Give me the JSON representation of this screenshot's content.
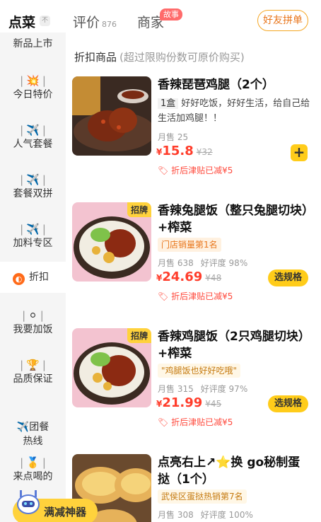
{
  "tabs": {
    "order": {
      "label": "点菜",
      "badge": "不"
    },
    "review": {
      "label": "评价",
      "count": "876"
    },
    "merchant": {
      "label": "商家",
      "badge": "故事"
    },
    "friend_group": "好友拼单"
  },
  "sidebar": {
    "items": [
      {
        "label": "新品上市",
        "icon": ""
      },
      {
        "label": "今日特价",
        "icon": "💥"
      },
      {
        "label": "人气套餐",
        "icon": "✈️"
      },
      {
        "label": "套餐双拼",
        "icon": "✈️"
      },
      {
        "label": "加料专区",
        "icon": "✈️"
      },
      {
        "label": "折扣",
        "icon": "◐"
      },
      {
        "label": "我要加饭",
        "icon": "⚪"
      },
      {
        "label": "品质保证",
        "icon": "🏆"
      },
      {
        "label": "✈️团餐\n热线",
        "icon": ""
      },
      {
        "label": "来点喝的",
        "icon": "🥇"
      }
    ]
  },
  "section": {
    "title": "折扣商品",
    "subtitle": "(超过限购份数可原价购买)"
  },
  "items": [
    {
      "name": "香辣琵琶鸡腿（2个）",
      "unit": "1盒",
      "desc": "好好吃饭，好好生活，给自己给生活加鸡腿！！",
      "sales": "月售 25",
      "rating": "",
      "currency": "¥",
      "price": "15.8",
      "original": "¥32",
      "discount": "折后津贴已减¥5",
      "tag": ""
    },
    {
      "name": "香辣兔腿饭（整只兔腿切块）+榨菜",
      "label": "门店销量第1名",
      "sales": "月售 638",
      "rating": "好评度 98%",
      "currency": "¥",
      "price": "24.69",
      "original": "¥48",
      "discount": "折后津贴已减¥5",
      "tag": "招牌",
      "button": "选规格"
    },
    {
      "name": "香辣鸡腿饭（2只鸡腿切块）+榨菜",
      "label": "\"鸡腿饭也好好吃哦\"",
      "sales": "月售 315",
      "rating": "好评度 97%",
      "currency": "¥",
      "price": "21.99",
      "original": "¥45",
      "discount": "折后津贴已减¥5",
      "tag": "招牌",
      "button": "选规格"
    },
    {
      "name": "点亮右上↗⭐换 go秘制蛋挞（1个）",
      "label": "武侯区蛋挞热销第7名",
      "sales": "月售 308",
      "rating": "好评度 100%"
    }
  ],
  "promo": {
    "label": "满减神器"
  },
  "colors": {
    "accent": "#ffcc1a",
    "price": "#ff3d2b",
    "brand_orange": "#e8761c"
  }
}
